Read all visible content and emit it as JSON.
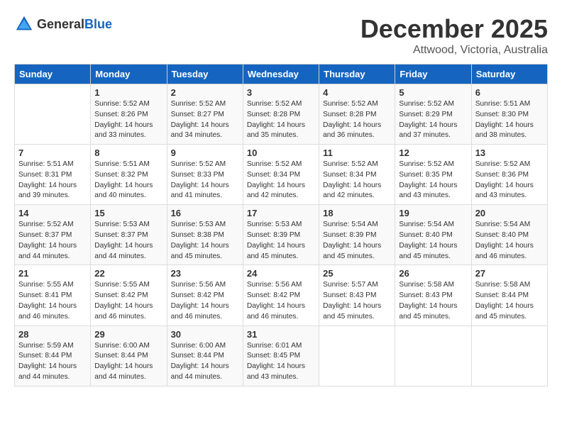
{
  "logo": {
    "text_general": "General",
    "text_blue": "Blue"
  },
  "title": {
    "month": "December 2025",
    "location": "Attwood, Victoria, Australia"
  },
  "headers": [
    "Sunday",
    "Monday",
    "Tuesday",
    "Wednesday",
    "Thursday",
    "Friday",
    "Saturday"
  ],
  "weeks": [
    [
      {
        "day": "",
        "content": ""
      },
      {
        "day": "1",
        "content": "Sunrise: 5:52 AM\nSunset: 8:26 PM\nDaylight: 14 hours\nand 33 minutes."
      },
      {
        "day": "2",
        "content": "Sunrise: 5:52 AM\nSunset: 8:27 PM\nDaylight: 14 hours\nand 34 minutes."
      },
      {
        "day": "3",
        "content": "Sunrise: 5:52 AM\nSunset: 8:28 PM\nDaylight: 14 hours\nand 35 minutes."
      },
      {
        "day": "4",
        "content": "Sunrise: 5:52 AM\nSunset: 8:28 PM\nDaylight: 14 hours\nand 36 minutes."
      },
      {
        "day": "5",
        "content": "Sunrise: 5:52 AM\nSunset: 8:29 PM\nDaylight: 14 hours\nand 37 minutes."
      },
      {
        "day": "6",
        "content": "Sunrise: 5:51 AM\nSunset: 8:30 PM\nDaylight: 14 hours\nand 38 minutes."
      }
    ],
    [
      {
        "day": "7",
        "content": "Sunrise: 5:51 AM\nSunset: 8:31 PM\nDaylight: 14 hours\nand 39 minutes."
      },
      {
        "day": "8",
        "content": "Sunrise: 5:51 AM\nSunset: 8:32 PM\nDaylight: 14 hours\nand 40 minutes."
      },
      {
        "day": "9",
        "content": "Sunrise: 5:52 AM\nSunset: 8:33 PM\nDaylight: 14 hours\nand 41 minutes."
      },
      {
        "day": "10",
        "content": "Sunrise: 5:52 AM\nSunset: 8:34 PM\nDaylight: 14 hours\nand 42 minutes."
      },
      {
        "day": "11",
        "content": "Sunrise: 5:52 AM\nSunset: 8:34 PM\nDaylight: 14 hours\nand 42 minutes."
      },
      {
        "day": "12",
        "content": "Sunrise: 5:52 AM\nSunset: 8:35 PM\nDaylight: 14 hours\nand 43 minutes."
      },
      {
        "day": "13",
        "content": "Sunrise: 5:52 AM\nSunset: 8:36 PM\nDaylight: 14 hours\nand 43 minutes."
      }
    ],
    [
      {
        "day": "14",
        "content": "Sunrise: 5:52 AM\nSunset: 8:37 PM\nDaylight: 14 hours\nand 44 minutes."
      },
      {
        "day": "15",
        "content": "Sunrise: 5:53 AM\nSunset: 8:37 PM\nDaylight: 14 hours\nand 44 minutes."
      },
      {
        "day": "16",
        "content": "Sunrise: 5:53 AM\nSunset: 8:38 PM\nDaylight: 14 hours\nand 45 minutes."
      },
      {
        "day": "17",
        "content": "Sunrise: 5:53 AM\nSunset: 8:39 PM\nDaylight: 14 hours\nand 45 minutes."
      },
      {
        "day": "18",
        "content": "Sunrise: 5:54 AM\nSunset: 8:39 PM\nDaylight: 14 hours\nand 45 minutes."
      },
      {
        "day": "19",
        "content": "Sunrise: 5:54 AM\nSunset: 8:40 PM\nDaylight: 14 hours\nand 45 minutes."
      },
      {
        "day": "20",
        "content": "Sunrise: 5:54 AM\nSunset: 8:40 PM\nDaylight: 14 hours\nand 46 minutes."
      }
    ],
    [
      {
        "day": "21",
        "content": "Sunrise: 5:55 AM\nSunset: 8:41 PM\nDaylight: 14 hours\nand 46 minutes."
      },
      {
        "day": "22",
        "content": "Sunrise: 5:55 AM\nSunset: 8:42 PM\nDaylight: 14 hours\nand 46 minutes."
      },
      {
        "day": "23",
        "content": "Sunrise: 5:56 AM\nSunset: 8:42 PM\nDaylight: 14 hours\nand 46 minutes."
      },
      {
        "day": "24",
        "content": "Sunrise: 5:56 AM\nSunset: 8:42 PM\nDaylight: 14 hours\nand 46 minutes."
      },
      {
        "day": "25",
        "content": "Sunrise: 5:57 AM\nSunset: 8:43 PM\nDaylight: 14 hours\nand 45 minutes."
      },
      {
        "day": "26",
        "content": "Sunrise: 5:58 AM\nSunset: 8:43 PM\nDaylight: 14 hours\nand 45 minutes."
      },
      {
        "day": "27",
        "content": "Sunrise: 5:58 AM\nSunset: 8:44 PM\nDaylight: 14 hours\nand 45 minutes."
      }
    ],
    [
      {
        "day": "28",
        "content": "Sunrise: 5:59 AM\nSunset: 8:44 PM\nDaylight: 14 hours\nand 44 minutes."
      },
      {
        "day": "29",
        "content": "Sunrise: 6:00 AM\nSunset: 8:44 PM\nDaylight: 14 hours\nand 44 minutes."
      },
      {
        "day": "30",
        "content": "Sunrise: 6:00 AM\nSunset: 8:44 PM\nDaylight: 14 hours\nand 44 minutes."
      },
      {
        "day": "31",
        "content": "Sunrise: 6:01 AM\nSunset: 8:45 PM\nDaylight: 14 hours\nand 43 minutes."
      },
      {
        "day": "",
        "content": ""
      },
      {
        "day": "",
        "content": ""
      },
      {
        "day": "",
        "content": ""
      }
    ]
  ]
}
